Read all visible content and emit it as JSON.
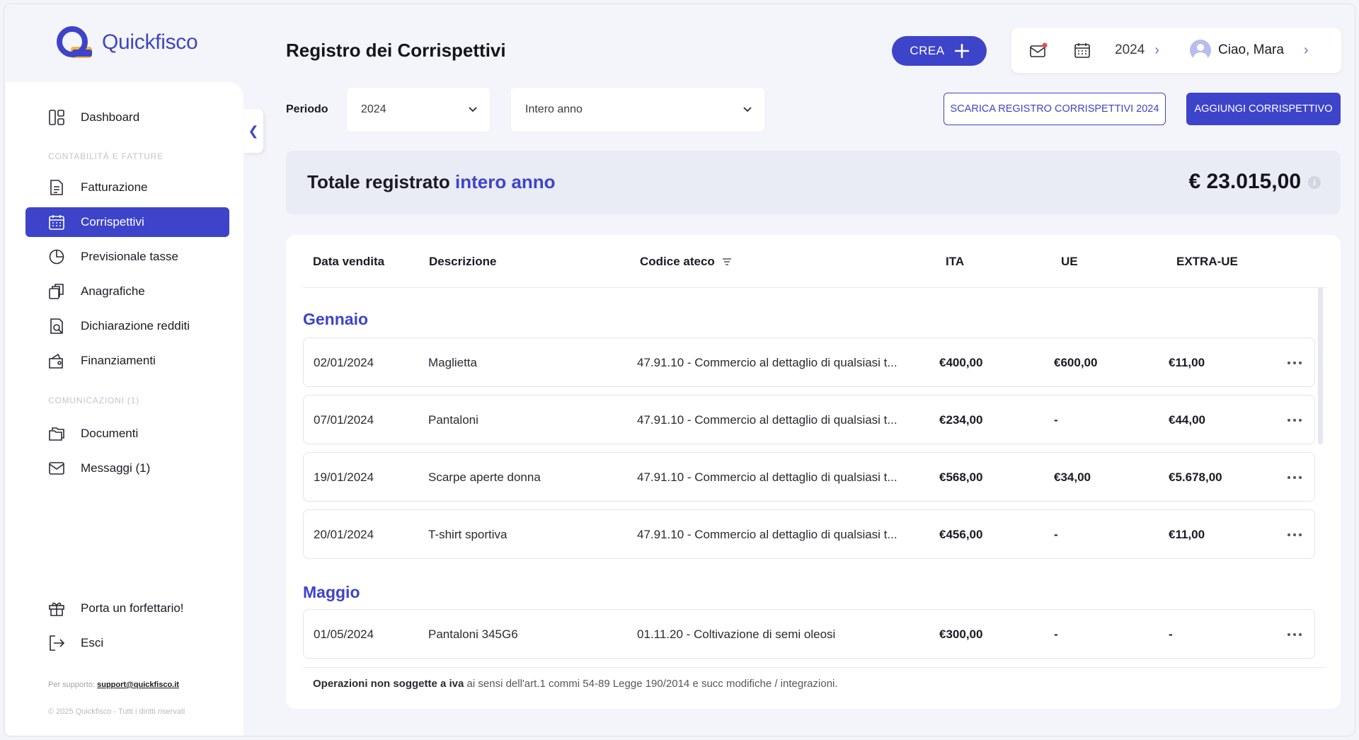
{
  "brand": {
    "name": "Quickfisco",
    "primary": "#3d44c9",
    "accent_yellow": "#f4b53a"
  },
  "sidebar": {
    "items_top": [
      {
        "label": "Dashboard",
        "icon": "dashboard-icon"
      }
    ],
    "section_contabilita": "CONTABILITÀ E FATTURE",
    "items_contabilita": [
      {
        "label": "Fatturazione",
        "icon": "invoice-icon"
      },
      {
        "label": "Corrispettivi",
        "icon": "calendar-register-icon",
        "active": true
      },
      {
        "label": "Previsionale tasse",
        "icon": "pie-chart-icon"
      },
      {
        "label": "Anagrafiche",
        "icon": "contacts-icon"
      },
      {
        "label": "Dichiarazione redditi",
        "icon": "tax-return-icon"
      },
      {
        "label": "Finanziamenti",
        "icon": "financing-icon"
      }
    ],
    "section_comunicazioni": "COMUNICAZIONI (1)",
    "items_comunicazioni": [
      {
        "label": "Documenti",
        "icon": "folder-icon"
      },
      {
        "label": "Messaggi (1)",
        "icon": "mail-icon"
      }
    ],
    "items_bottom": [
      {
        "label": "Porta un forfettario!",
        "icon": "gift-icon"
      },
      {
        "label": "Esci",
        "icon": "logout-icon"
      }
    ],
    "support_prefix": "Per supporto:",
    "support_email": "support@quickfisco.it",
    "copyright": "© 2025 Quickfisco - Tutti i diritti riservati"
  },
  "header": {
    "title": "Registro dei Corrispettivi",
    "crea_label": "CREA",
    "year": "2024",
    "greeting": "Ciao, Mara"
  },
  "filters": {
    "periodo_label": "Periodo",
    "year_value": "2024",
    "range_value": "Intero anno",
    "download_label": "SCARICA REGISTRO CORRISPETTIVI 2024",
    "add_label": "AGGIUNGI CORRISPETTIVO"
  },
  "totale": {
    "label": "Totale registrato",
    "accent": "intero anno",
    "amount": "€ 23.015,00"
  },
  "table": {
    "headers": {
      "data": "Data vendita",
      "descrizione": "Descrizione",
      "ateco": "Codice ateco",
      "ita": "ITA",
      "ue": "UE",
      "extra": "EXTRA-UE"
    },
    "groups": [
      {
        "month": "Gennaio",
        "rows": [
          {
            "data": "02/01/2024",
            "descrizione": "Maglietta",
            "ateco": "47.91.10 - Commercio al dettaglio di qualsiasi t...",
            "ita": "€400,00",
            "ue": "€600,00",
            "extra": "€11,00"
          },
          {
            "data": "07/01/2024",
            "descrizione": "Pantaloni",
            "ateco": "47.91.10 - Commercio al dettaglio di qualsiasi t...",
            "ita": "€234,00",
            "ue": "-",
            "extra": "€44,00"
          },
          {
            "data": "19/01/2024",
            "descrizione": "Scarpe aperte donna",
            "ateco": "47.91.10 - Commercio al dettaglio di qualsiasi t...",
            "ita": "€568,00",
            "ue": "€34,00",
            "extra": "€5.678,00"
          },
          {
            "data": "20/01/2024",
            "descrizione": "T-shirt sportiva",
            "ateco": "47.91.10 - Commercio al dettaglio di qualsiasi t...",
            "ita": "€456,00",
            "ue": "-",
            "extra": "€11,00"
          }
        ]
      },
      {
        "month": "Maggio",
        "rows": [
          {
            "data": "01/05/2024",
            "descrizione": "Pantaloni 345G6",
            "ateco": "01.11.20 - Coltivazione di semi oleosi",
            "ita": "€300,00",
            "ue": "-",
            "extra": "-"
          }
        ]
      }
    ],
    "footnote_bold": "Operazioni non soggette a iva",
    "footnote_rest": "ai sensi dell'art.1 commi 54-89 Legge 190/2014 e succ modifiche / integrazioni."
  }
}
